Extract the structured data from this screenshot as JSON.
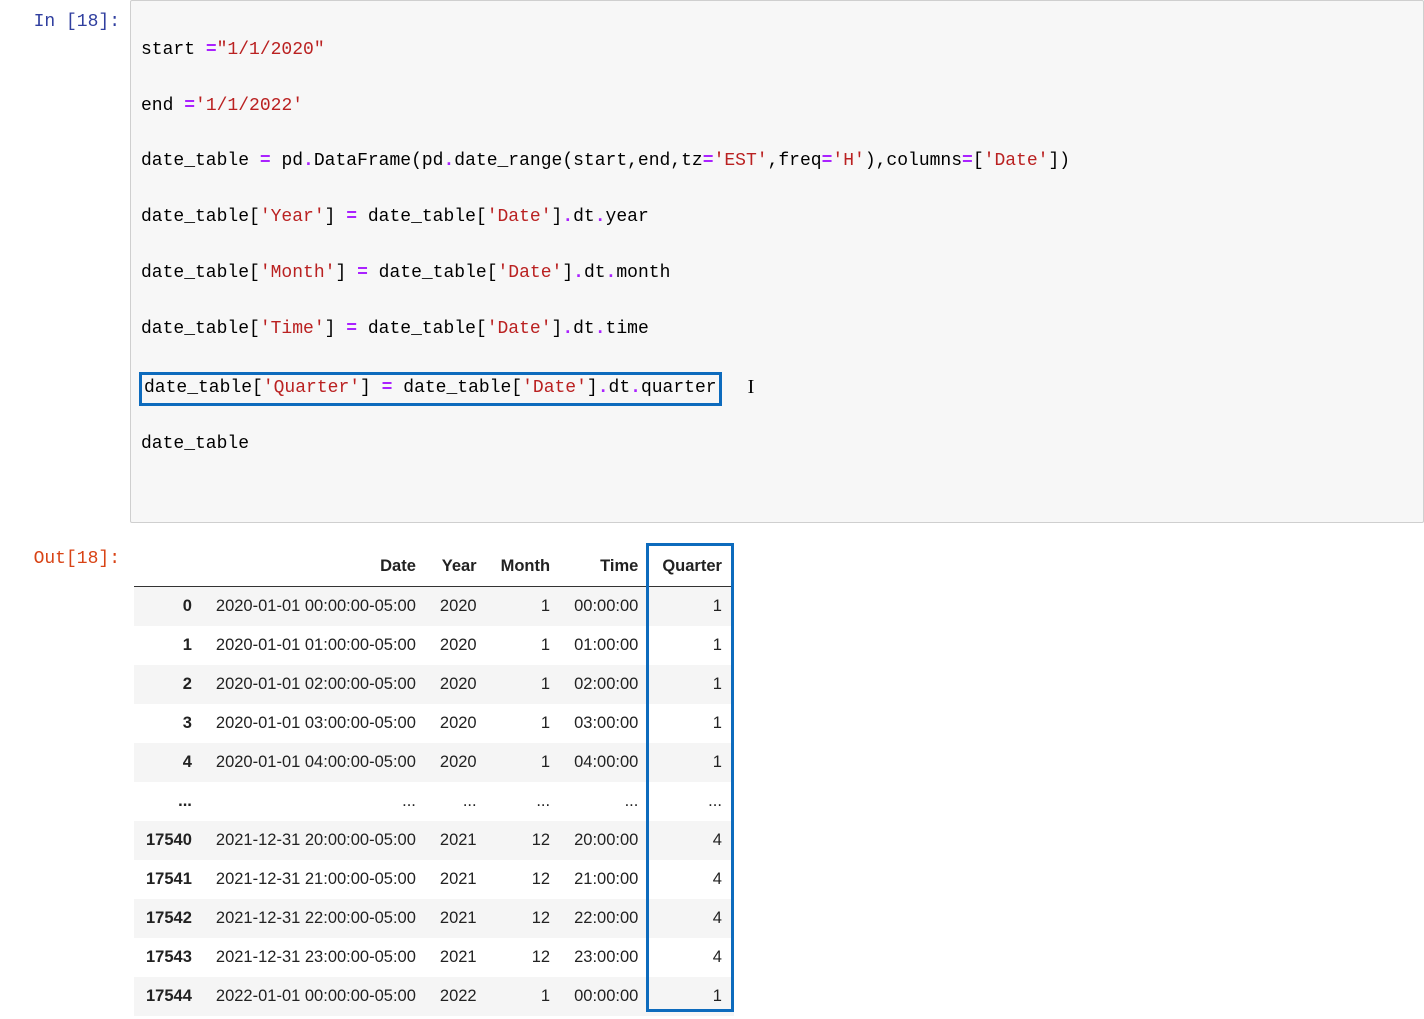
{
  "input_prompt": "In [18]:",
  "output_prompt": "Out[18]:",
  "code": {
    "l1": {
      "a": "start ",
      "op": "=",
      "b": "\"1/1/2020\""
    },
    "l2": {
      "a": "end ",
      "op": "=",
      "b": "'1/1/2022'"
    },
    "l3": {
      "a": "date_table ",
      "op1": "=",
      "b": " pd",
      "dot1": ".",
      "c": "DataFrame(pd",
      "dot2": ".",
      "d": "date_range(start,end,tz",
      "op2": "=",
      "e": "'EST'",
      "f": ",freq",
      "op3": "=",
      "g": "'H'",
      "h": "),columns",
      "op4": "=",
      "i": "[",
      "j": "'Date'",
      "k": "])"
    },
    "l4": {
      "a": "date_table[",
      "s": "'Year'",
      "b": "] ",
      "op": "=",
      "c": " date_table[",
      "s2": "'Date'",
      "d": "]",
      "dot": ".",
      "e": "dt",
      "dot2": ".",
      "f": "year"
    },
    "l5": {
      "a": "date_table[",
      "s": "'Month'",
      "b": "] ",
      "op": "=",
      "c": " date_table[",
      "s2": "'Date'",
      "d": "]",
      "dot": ".",
      "e": "dt",
      "dot2": ".",
      "f": "month"
    },
    "l6": {
      "a": "date_table[",
      "s": "'Time'",
      "b": "] ",
      "op": "=",
      "c": " date_table[",
      "s2": "'Date'",
      "d": "]",
      "dot": ".",
      "e": "dt",
      "dot2": ".",
      "f": "time"
    },
    "l7": {
      "a": "date_table[",
      "s": "'Quarter'",
      "b": "] ",
      "op": "=",
      "c": " date_table[",
      "s2": "'Date'",
      "d": "]",
      "dot": ".",
      "e": "dt",
      "dot2": ".",
      "f": "quarter"
    },
    "l8": "date_table"
  },
  "table": {
    "headers": [
      "",
      "Date",
      "Year",
      "Month",
      "Time",
      "Quarter"
    ],
    "rows": [
      {
        "idx": "0",
        "Date": "2020-01-01 00:00:00-05:00",
        "Year": "2020",
        "Month": "1",
        "Time": "00:00:00",
        "Quarter": "1"
      },
      {
        "idx": "1",
        "Date": "2020-01-01 01:00:00-05:00",
        "Year": "2020",
        "Month": "1",
        "Time": "01:00:00",
        "Quarter": "1"
      },
      {
        "idx": "2",
        "Date": "2020-01-01 02:00:00-05:00",
        "Year": "2020",
        "Month": "1",
        "Time": "02:00:00",
        "Quarter": "1"
      },
      {
        "idx": "3",
        "Date": "2020-01-01 03:00:00-05:00",
        "Year": "2020",
        "Month": "1",
        "Time": "03:00:00",
        "Quarter": "1"
      },
      {
        "idx": "4",
        "Date": "2020-01-01 04:00:00-05:00",
        "Year": "2020",
        "Month": "1",
        "Time": "04:00:00",
        "Quarter": "1"
      },
      {
        "idx": "...",
        "Date": "...",
        "Year": "...",
        "Month": "...",
        "Time": "...",
        "Quarter": "..."
      },
      {
        "idx": "17540",
        "Date": "2021-12-31 20:00:00-05:00",
        "Year": "2021",
        "Month": "12",
        "Time": "20:00:00",
        "Quarter": "4"
      },
      {
        "idx": "17541",
        "Date": "2021-12-31 21:00:00-05:00",
        "Year": "2021",
        "Month": "12",
        "Time": "21:00:00",
        "Quarter": "4"
      },
      {
        "idx": "17542",
        "Date": "2021-12-31 22:00:00-05:00",
        "Year": "2021",
        "Month": "12",
        "Time": "22:00:00",
        "Quarter": "4"
      },
      {
        "idx": "17543",
        "Date": "2021-12-31 23:00:00-05:00",
        "Year": "2021",
        "Month": "12",
        "Time": "23:00:00",
        "Quarter": "4"
      },
      {
        "idx": "17544",
        "Date": "2022-01-01 00:00:00-05:00",
        "Year": "2022",
        "Month": "1",
        "Time": "00:00:00",
        "Quarter": "1"
      }
    ]
  },
  "highlight": {
    "column": "Quarter",
    "code_line": 7
  }
}
